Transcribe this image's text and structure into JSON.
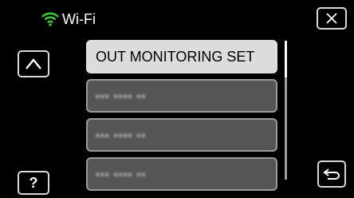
{
  "header": {
    "title": "Wi-Fi",
    "wifi_icon_color": "#3fbf3f"
  },
  "menu": {
    "items": [
      {
        "label": "OUT MONITORING SET",
        "state": "selected"
      },
      {
        "label": "▪▪▪ ▪▪▪▪ ▪▪",
        "state": "dim"
      },
      {
        "label": "▪▪▪ ▪▪▪▪ ▪▪",
        "state": "dim"
      },
      {
        "label": "▪▪▪ ▪▪▪▪ ▪▪",
        "state": "dim"
      }
    ]
  },
  "controls": {
    "help_label": "?",
    "close_icon": "close-icon",
    "up_icon": "chevron-up-icon",
    "back_icon": "return-icon"
  },
  "colors": {
    "background": "#000000",
    "button_border": "#d8d8d8",
    "selected_bg": "#dcdcdc",
    "dim_bg": "#555555"
  }
}
